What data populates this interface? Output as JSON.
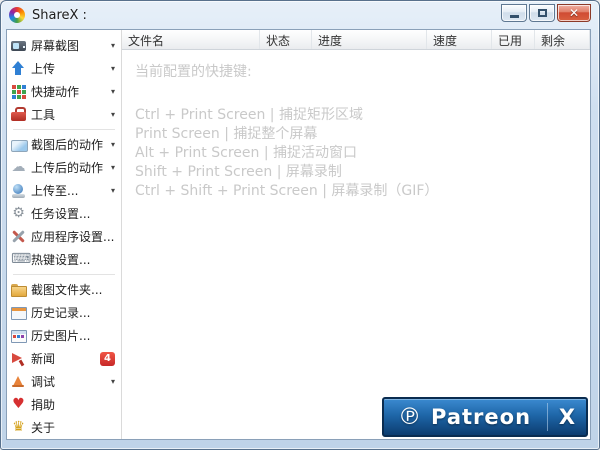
{
  "window": {
    "title": "ShareX :"
  },
  "sidebar": {
    "items": [
      {
        "label": "屏幕截图",
        "icon": "screen-capture-icon",
        "arrow": true
      },
      {
        "label": "上传",
        "icon": "upload-icon",
        "arrow": true
      },
      {
        "label": "快捷动作",
        "icon": "quick-actions-icon",
        "arrow": true
      },
      {
        "label": "工具",
        "icon": "toolbox-icon",
        "arrow": true
      },
      {
        "separator": true
      },
      {
        "label": "截图后的动作",
        "icon": "after-capture-icon",
        "arrow": true
      },
      {
        "label": "上传后的动作",
        "icon": "after-upload-icon",
        "arrow": true
      },
      {
        "label": "上传至...",
        "icon": "upload-to-icon",
        "arrow": true
      },
      {
        "label": "任务设置...",
        "icon": "task-settings-icon"
      },
      {
        "label": "应用程序设置...",
        "icon": "app-settings-icon"
      },
      {
        "label": "热键设置...",
        "icon": "hotkey-settings-icon"
      },
      {
        "separator": true
      },
      {
        "label": "截图文件夹...",
        "icon": "screenshots-folder-icon"
      },
      {
        "label": "历史记录...",
        "icon": "history-icon"
      },
      {
        "label": "历史图片...",
        "icon": "image-history-icon"
      },
      {
        "label": "新闻",
        "icon": "news-icon",
        "badge": "4"
      },
      {
        "label": "调试",
        "icon": "debug-icon",
        "arrow": true
      },
      {
        "label": "捐助",
        "icon": "donate-icon"
      },
      {
        "label": "关于",
        "icon": "about-icon"
      }
    ]
  },
  "table": {
    "columns": [
      "文件名",
      "状态",
      "进度",
      "速度",
      "已用",
      "剩余"
    ]
  },
  "content": {
    "hotkeys_title": "当前配置的快捷键:",
    "hotkeys": [
      "Ctrl + Print Screen | 捕捉矩形区域",
      "Print Screen | 捕捉整个屏幕",
      "Alt + Print Screen | 捕捉活动窗口",
      "Shift + Print Screen | 屏幕录制",
      "Ctrl + Shift + Print Screen | 屏幕录制（GIF）"
    ]
  },
  "patreon": {
    "brand": "Patreon",
    "close_label": "X"
  },
  "colors": {
    "accent_blue": "#2f80d4",
    "patreon_blue": "#1e66a8",
    "badge_red": "#c62828",
    "hotkey_text_gray": "#c9c9c9"
  }
}
